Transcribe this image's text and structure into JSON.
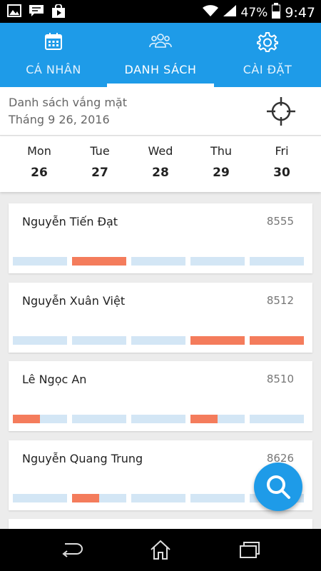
{
  "status_bar": {
    "icons": [
      "image-icon",
      "chat-icon",
      "store-icon",
      "wifi-icon",
      "signal-icon",
      "battery-icon"
    ],
    "battery": "47%",
    "time": "9:47"
  },
  "tabs": [
    {
      "label": "CÁ NHÂN",
      "icon": "calendar-icon",
      "active": false
    },
    {
      "label": "DANH SÁCH",
      "icon": "group-icon",
      "active": true
    },
    {
      "label": "CÀI ĐẶT",
      "icon": "gear-icon",
      "active": false
    }
  ],
  "header": {
    "title": "Danh sách vắng mặt",
    "date": "Tháng 9 26, 2016"
  },
  "week": [
    {
      "name": "Mon",
      "num": "26"
    },
    {
      "name": "Tue",
      "num": "27"
    },
    {
      "name": "Wed",
      "num": "28"
    },
    {
      "name": "Thu",
      "num": "29"
    },
    {
      "name": "Fri",
      "num": "30"
    }
  ],
  "employees": [
    {
      "name": "Nguyễn Tiến Đạt",
      "id": "8555",
      "absence": [
        0,
        1,
        0,
        0,
        0
      ]
    },
    {
      "name": "Nguyễn Xuân Việt",
      "id": "8512",
      "absence": [
        0,
        0,
        0,
        1,
        1
      ]
    },
    {
      "name": "Lê Ngọc An",
      "id": "8510",
      "absence": [
        0.5,
        0,
        0,
        0.5,
        0
      ]
    },
    {
      "name": "Nguyễn Quang Trung",
      "id": "8626",
      "absence": [
        0,
        0.5,
        0,
        0,
        0
      ]
    }
  ],
  "colors": {
    "primary": "#1e9be8",
    "absent": "#f47c5c",
    "present": "#d3e6f5"
  }
}
